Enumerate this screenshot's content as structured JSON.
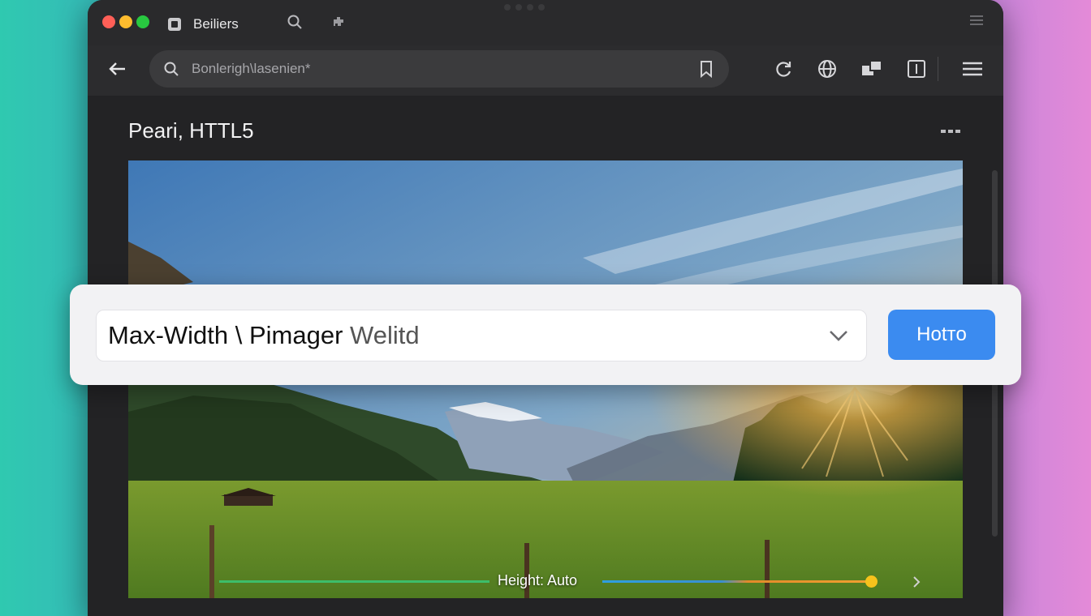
{
  "tab": {
    "title": "Beiliers"
  },
  "address_bar": {
    "value": "Bonlerigh\\lasenien*"
  },
  "page": {
    "title": "Peari, HTTL5"
  },
  "dropdown": {
    "value_bold": "Max-Width \\ Pimager",
    "value_light": "Welitd"
  },
  "go_button": {
    "label": "Hotтo"
  },
  "slider": {
    "label": "Height: Auto"
  },
  "colors": {
    "accent": "#3b8bf0",
    "window_bg": "#1f1f21",
    "toolbar_bg": "#2c2c2e"
  },
  "icons": [
    "close-window",
    "minimize-window",
    "maximize-window",
    "tab-favicon",
    "search-icon",
    "extension-icon",
    "tab-list-icon",
    "back-arrow-icon",
    "bookmark-icon",
    "refresh-icon",
    "globe-icon",
    "share-icon",
    "reader-icon",
    "menu-icon",
    "more-icon",
    "chevron-down-icon"
  ]
}
